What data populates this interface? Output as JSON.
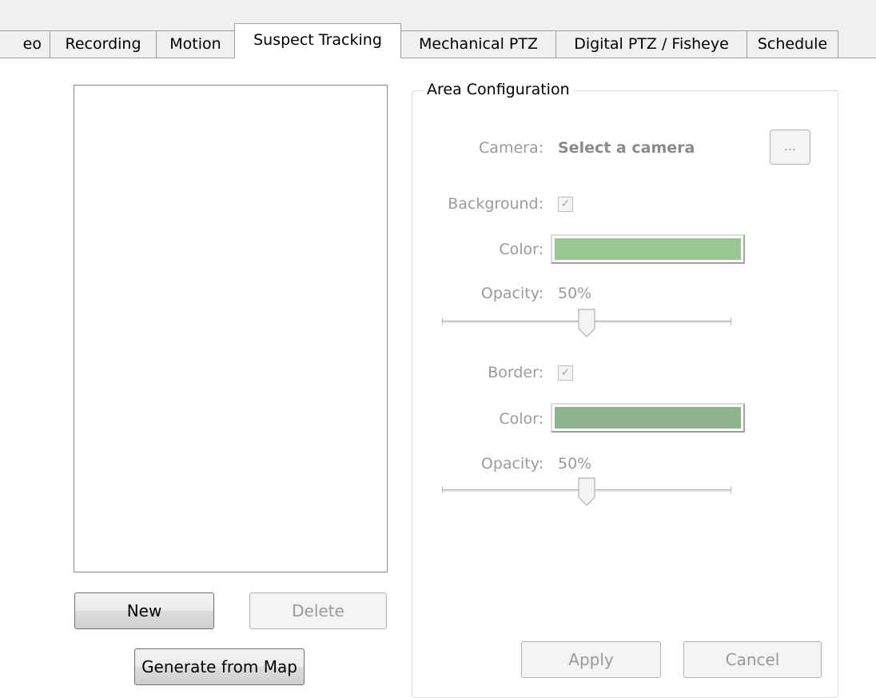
{
  "tabs": [
    {
      "label": "eo",
      "active": false
    },
    {
      "label": "Recording",
      "active": false
    },
    {
      "label": "Motion",
      "active": false
    },
    {
      "label": "Suspect Tracking",
      "active": true
    },
    {
      "label": "Mechanical PTZ",
      "active": false
    },
    {
      "label": "Digital PTZ / Fisheye",
      "active": false
    },
    {
      "label": "Schedule",
      "active": false
    }
  ],
  "list": {
    "new_label": "New",
    "delete_label": "Delete",
    "generate_label": "Generate from Map"
  },
  "area_config": {
    "title": "Area Configuration",
    "camera_label": "Camera:",
    "camera_value": "Select a camera",
    "browse_label": "...",
    "background_label": "Background:",
    "background_checked": true,
    "bg_color_label": "Color:",
    "bg_color": "#98c794",
    "bg_opacity_label": "Opacity:",
    "bg_opacity_value": "50%",
    "bg_opacity_fraction": 0.5,
    "border_label": "Border:",
    "border_checked": true,
    "border_color_label": "Color:",
    "border_color": "#8fb38d",
    "border_opacity_label": "Opacity:",
    "border_opacity_value": "50%",
    "border_opacity_fraction": 0.5,
    "apply_label": "Apply",
    "cancel_label": "Cancel"
  }
}
